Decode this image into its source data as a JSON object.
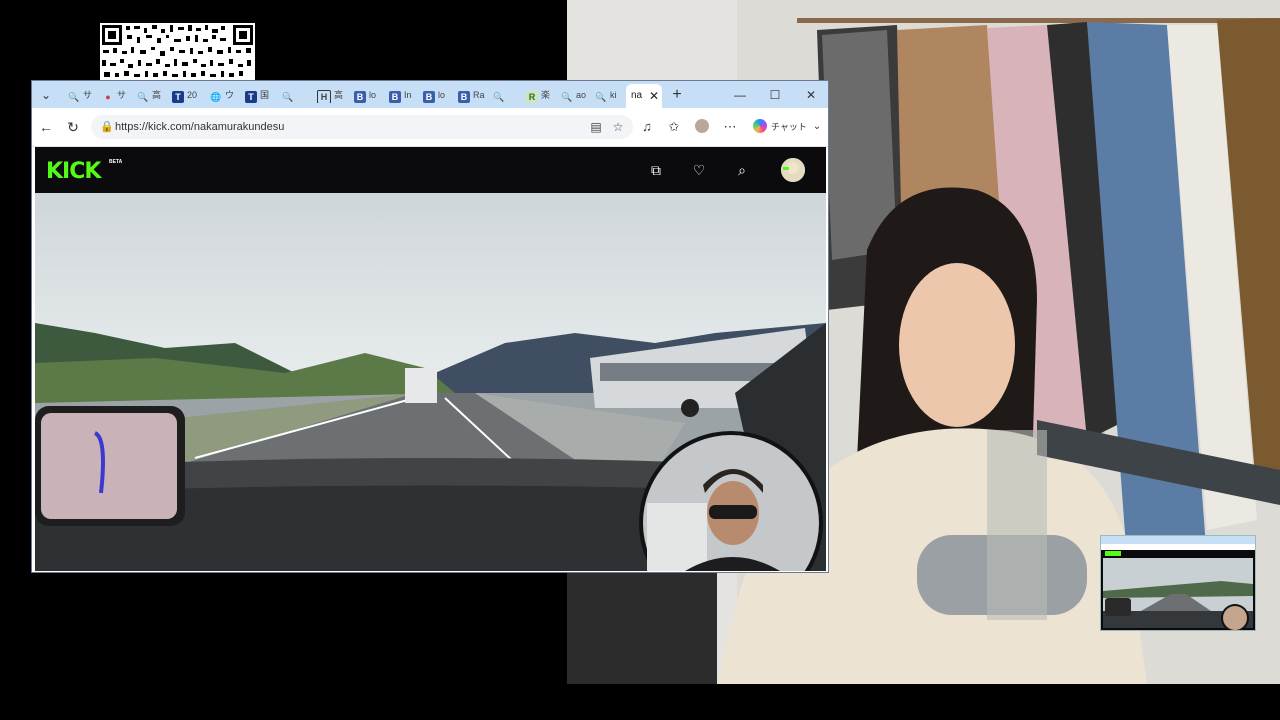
{
  "browser": {
    "tabs": [
      {
        "glyph": "🔍",
        "label": "サ"
      },
      {
        "glyph": "●",
        "label": "サ"
      },
      {
        "glyph": "🔍",
        "label": "高"
      },
      {
        "glyph": "T",
        "label": "20"
      },
      {
        "glyph": "🌐",
        "label": "ウ"
      },
      {
        "glyph": "T",
        "label": "国"
      },
      {
        "glyph": "🔍",
        "label": ""
      },
      {
        "glyph": "H",
        "label": "高"
      },
      {
        "glyph": "B",
        "label": "lo"
      },
      {
        "glyph": "B",
        "label": "In"
      },
      {
        "glyph": "B",
        "label": "lo"
      },
      {
        "glyph": "B",
        "label": "Ra"
      },
      {
        "glyph": "🔍",
        "label": ""
      },
      {
        "glyph": "R",
        "label": "楽"
      },
      {
        "glyph": "🔍",
        "label": "ao"
      },
      {
        "glyph": "🔍",
        "label": "ki"
      }
    ],
    "active_tab": {
      "label": "na"
    },
    "url": "https://kick.com/nakamurakundesu",
    "copilot_label": "チャット"
  },
  "kick": {
    "logo": "KICK",
    "beta": "BETA"
  },
  "colors": {
    "kick_green": "#53fc18",
    "tabstrip": "#c6dff6"
  }
}
